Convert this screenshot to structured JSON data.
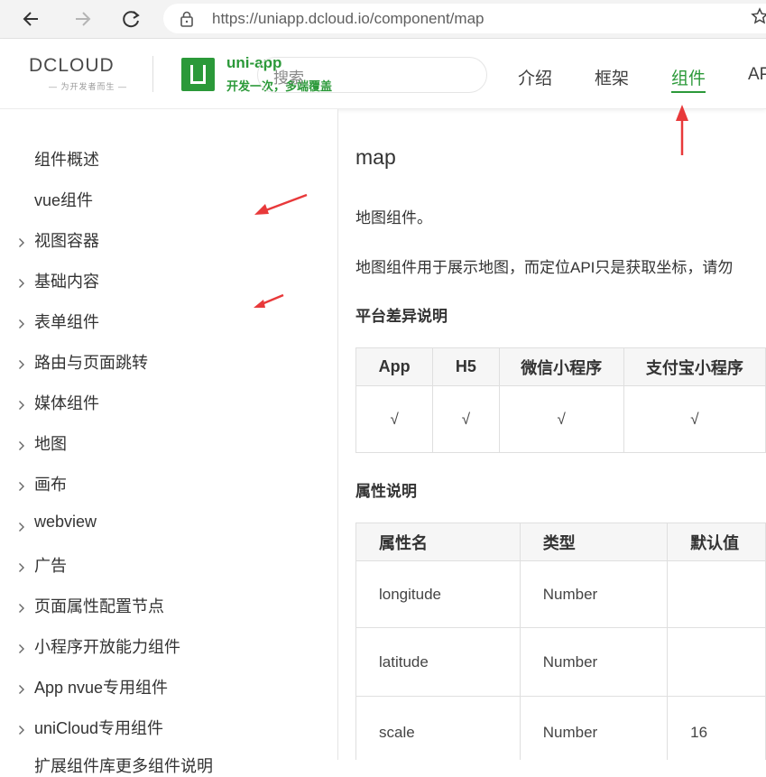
{
  "browser": {
    "url": "https://uniapp.dcloud.io/component/map"
  },
  "header": {
    "dcloud_logo": "DCLOUD",
    "dcloud_tagline": "— 为开发者而生 —",
    "uni_app_name": "uni-app",
    "uni_app_slogan": "开发一次，多端覆盖",
    "search_placeholder": "搜索",
    "nav": [
      {
        "label": "介绍"
      },
      {
        "label": "框架"
      },
      {
        "label": "组件"
      },
      {
        "label": "AP"
      }
    ],
    "active_nav": "组件",
    "accent_color": "#2b9939"
  },
  "sidebar": {
    "items": [
      {
        "label": "组件概述"
      },
      {
        "label": "vue组件"
      },
      {
        "label": "视图容器"
      },
      {
        "label": "基础内容"
      },
      {
        "label": "表单组件"
      },
      {
        "label": "路由与页面跳转"
      },
      {
        "label": "媒体组件"
      },
      {
        "label": "地图"
      },
      {
        "label": "画布"
      },
      {
        "label": "webview"
      },
      {
        "label": "广告"
      },
      {
        "label": "页面属性配置节点"
      },
      {
        "label": "小程序开放能力组件"
      },
      {
        "label": "App nvue专用组件"
      },
      {
        "label": "uniCloud专用组件"
      },
      {
        "label": "扩展组件库更多组件说明"
      }
    ]
  },
  "content": {
    "title": "map",
    "intro": "地图组件。",
    "desc": "地图组件用于展示地图，而定位API只是获取坐标，请勿",
    "platform_title": "平台差异说明",
    "platform_table": {
      "headers": [
        "App",
        "H5",
        "微信小程序",
        "支付宝小程序"
      ],
      "row": [
        "√",
        "√",
        "√",
        "√"
      ]
    },
    "attr_title": "属性说明",
    "attr_table": {
      "headers": [
        "属性名",
        "类型",
        "默认值"
      ],
      "rows": [
        [
          "longitude",
          "Number",
          ""
        ],
        [
          "latitude",
          "Number",
          ""
        ],
        [
          "scale",
          "Number",
          "16"
        ]
      ]
    }
  },
  "annotation_color": "#e8393a"
}
